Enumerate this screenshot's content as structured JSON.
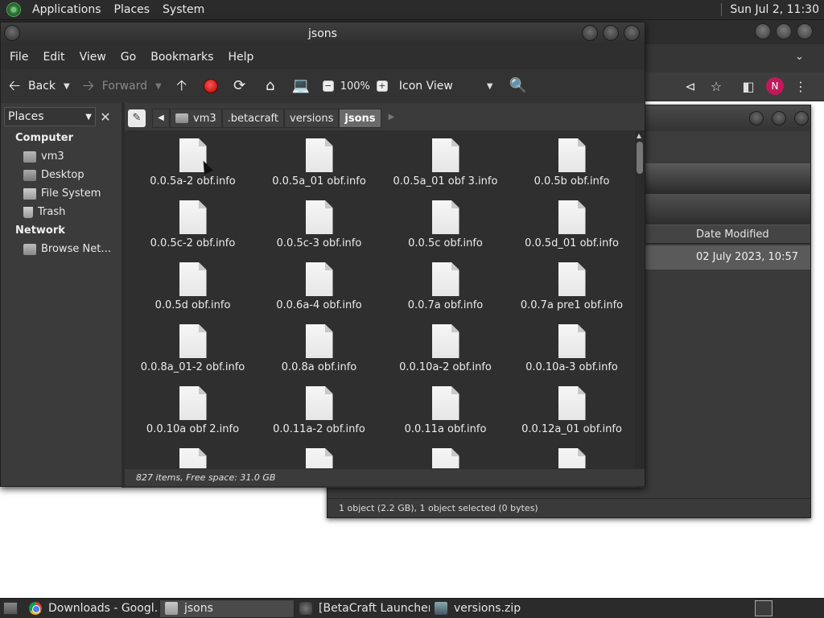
{
  "top_panel": {
    "menus": [
      "Applications",
      "Places",
      "System"
    ],
    "clock": "Sun Jul  2, 11:30"
  },
  "browser": {
    "profile_initial": "N"
  },
  "archive_window": {
    "column_date": "Date Modified",
    "row_date": "02 July 2023, 10:57",
    "status": "1 object (2.2 GB), 1 object selected (0 bytes)"
  },
  "file_manager": {
    "title": "jsons",
    "menus": [
      "File",
      "Edit",
      "View",
      "Go",
      "Bookmarks",
      "Help"
    ],
    "toolbar": {
      "back": "Back",
      "forward": "Forward",
      "zoom": "100%",
      "view_mode": "Icon View"
    },
    "sidebar": {
      "selector": "Places",
      "computer_heading": "Computer",
      "computer_items": [
        "vm3",
        "Desktop",
        "File System",
        "Trash"
      ],
      "network_heading": "Network",
      "network_items": [
        "Browse Net…"
      ]
    },
    "path": [
      "vm3",
      ".betacraft",
      "versions",
      "jsons"
    ],
    "files": [
      "0.0.5a-2 obf.info",
      "0.0.5a_01 obf.info",
      "0.0.5a_01 obf 3.info",
      "0.0.5b obf.info",
      "0.0.5c-2 obf.info",
      "0.0.5c-3 obf.info",
      "0.0.5c obf.info",
      "0.0.5d_01 obf.info",
      "0.0.5d obf.info",
      "0.0.6a-4 obf.info",
      "0.0.7a obf.info",
      "0.0.7a pre1 obf.info",
      "0.0.8a_01-2 obf.info",
      "0.0.8a obf.info",
      "0.0.10a-2 obf.info",
      "0.0.10a-3 obf.info",
      "0.0.10a obf 2.info",
      "0.0.11a-2 obf.info",
      "0.0.11a obf.info",
      "0.0.12a_01 obf.info",
      "",
      "",
      "",
      ""
    ],
    "status": "827 items, Free space: 31.0 GB"
  },
  "taskbar": {
    "tasks": [
      "Downloads - Googl…",
      "jsons",
      "[BetaCraft Launcher…",
      "versions.zip"
    ]
  }
}
